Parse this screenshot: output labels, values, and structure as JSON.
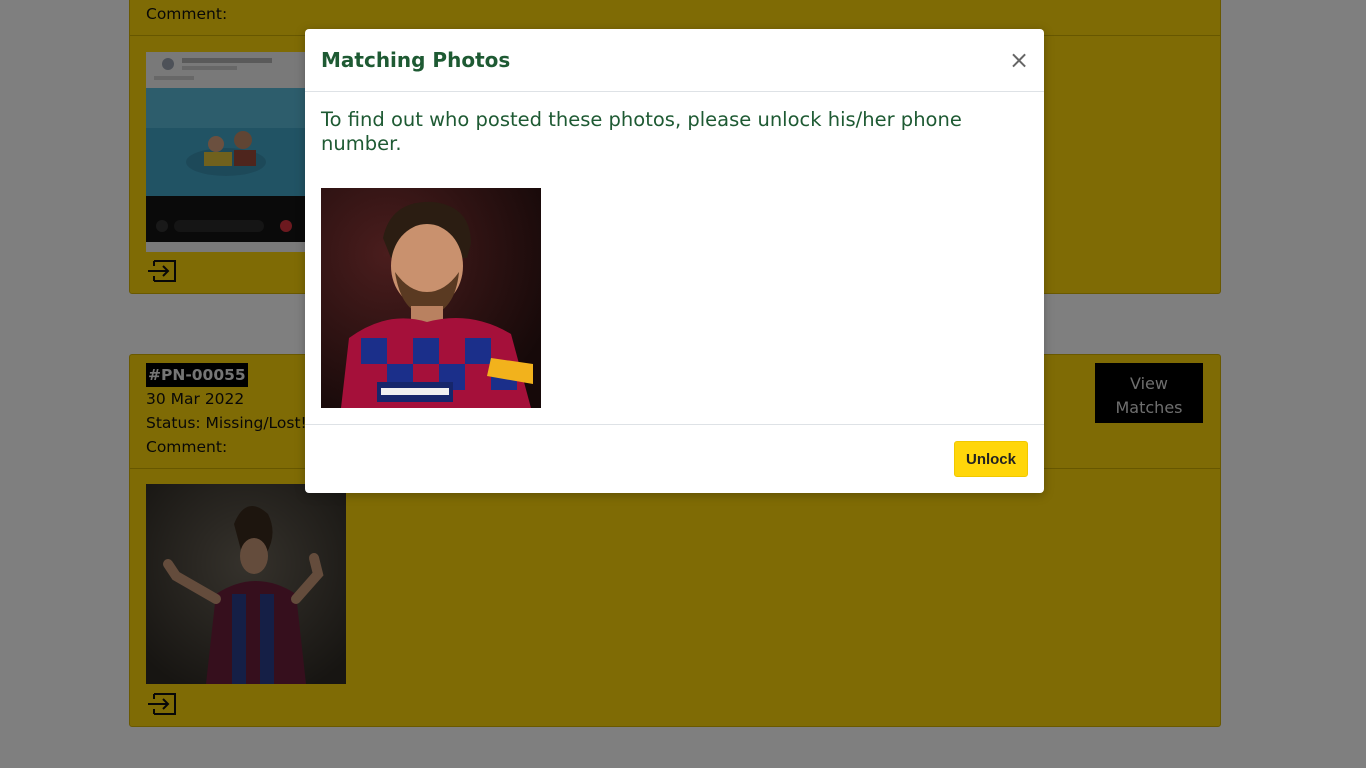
{
  "card_top": {
    "comment_label": "Comment:"
  },
  "card_bottom": {
    "ticket_id": "#PN-00055",
    "date": "30 Mar 2022",
    "status": "Status: Missing/Lost!",
    "comment_label": "Comment:",
    "view_matches_line1": "View",
    "view_matches_line2": "Matches"
  },
  "modal": {
    "title": "Matching Photos",
    "close_symbol": "×",
    "body_text": "To find out who posted these photos, please unlock his/her phone number.",
    "unlock_label": "Unlock"
  },
  "colors": {
    "card_bg": "#ffd60a",
    "modal_text": "#1e5a33",
    "unlock_bg": "#ffd60a"
  }
}
